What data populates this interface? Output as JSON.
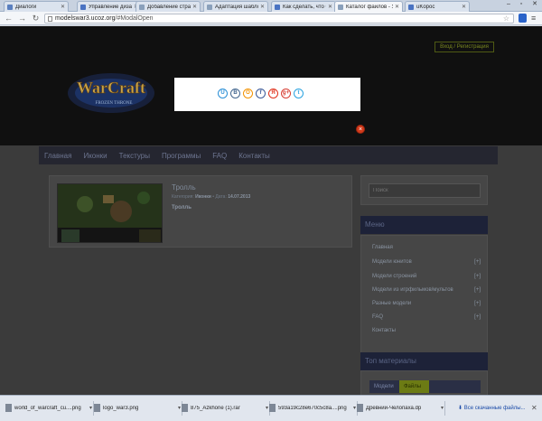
{
  "browser": {
    "tabs": [
      {
        "title": "Диалоги",
        "color": "#5a7fbf"
      },
      {
        "title": "Управление дизайн",
        "color": "#4a73c2"
      },
      {
        "title": "Добавление страни",
        "color": "#8aa0bb"
      },
      {
        "title": "Адаптация шаблон",
        "color": "#8aa0bb"
      },
      {
        "title": "Как сделать, что бы",
        "color": "#4a73c2"
      },
      {
        "title": "Каталог файлов - У",
        "color": "#8aa0bb"
      },
      {
        "title": "uKopoc",
        "color": "#4a73c2"
      }
    ],
    "active_tab_index": 5,
    "url_host": "modelswar3.ucoz.org",
    "url_path": "/#ModalOpen"
  },
  "site": {
    "login_link": "Вход / Регистрация",
    "logo_text": "WarCraft",
    "logo_subtitle": "FROZEN THRONE",
    "nav": [
      "Главная",
      "Иконки",
      "Текстуры",
      "Программы",
      "FAQ",
      "Контакты"
    ]
  },
  "entry": {
    "title": "Тролль",
    "category_label": "Категория:",
    "category": "Иконки",
    "date_label": "Дата:",
    "date": "14.07.2013",
    "description": "Тролль"
  },
  "sidebar": {
    "search_placeholder": "Поиск",
    "menu_title": "Меню",
    "menu_items": [
      {
        "label": "Главная",
        "plus": ""
      },
      {
        "label": "Модели юнитов",
        "plus": "[+]"
      },
      {
        "label": "Модели строений",
        "plus": "[+]"
      },
      {
        "label": "Модели из игрфильмов/мультов",
        "plus": "[+]"
      },
      {
        "label": "Разные модели",
        "plus": "[+]"
      },
      {
        "label": "FAQ",
        "plus": "[+]"
      },
      {
        "label": "Контакты",
        "plus": ""
      }
    ],
    "top_title": "Топ материалы",
    "top_tabs": [
      "Модели",
      "Файлы"
    ]
  },
  "modal": {
    "close_glyph": "×",
    "share_buttons": [
      {
        "glyph": "U",
        "color": "#2a8fd6",
        "name": "ucoz-share-icon"
      },
      {
        "glyph": "B",
        "color": "#44678f",
        "name": "vk-share-icon"
      },
      {
        "glyph": "O",
        "color": "#f29200",
        "name": "odnoklassniki-share-icon"
      },
      {
        "glyph": "f",
        "color": "#3b5998",
        "name": "facebook-share-icon"
      },
      {
        "glyph": "Я",
        "color": "#e0311b",
        "name": "yandex-share-icon"
      },
      {
        "glyph": "g+",
        "color": "#d73d32",
        "name": "google-plus-share-icon"
      },
      {
        "glyph": "t",
        "color": "#2aa3e0",
        "name": "twitter-share-icon"
      }
    ]
  },
  "downloads": {
    "items": [
      "world_of_warcraft_cu....png",
      "logo_war3.png",
      "875_Azkhone (1).rar",
      "593a19c28e670c5c8a....png",
      "Древний-Челопаха.dp"
    ],
    "show_all": "Все скачанные файлы..."
  }
}
